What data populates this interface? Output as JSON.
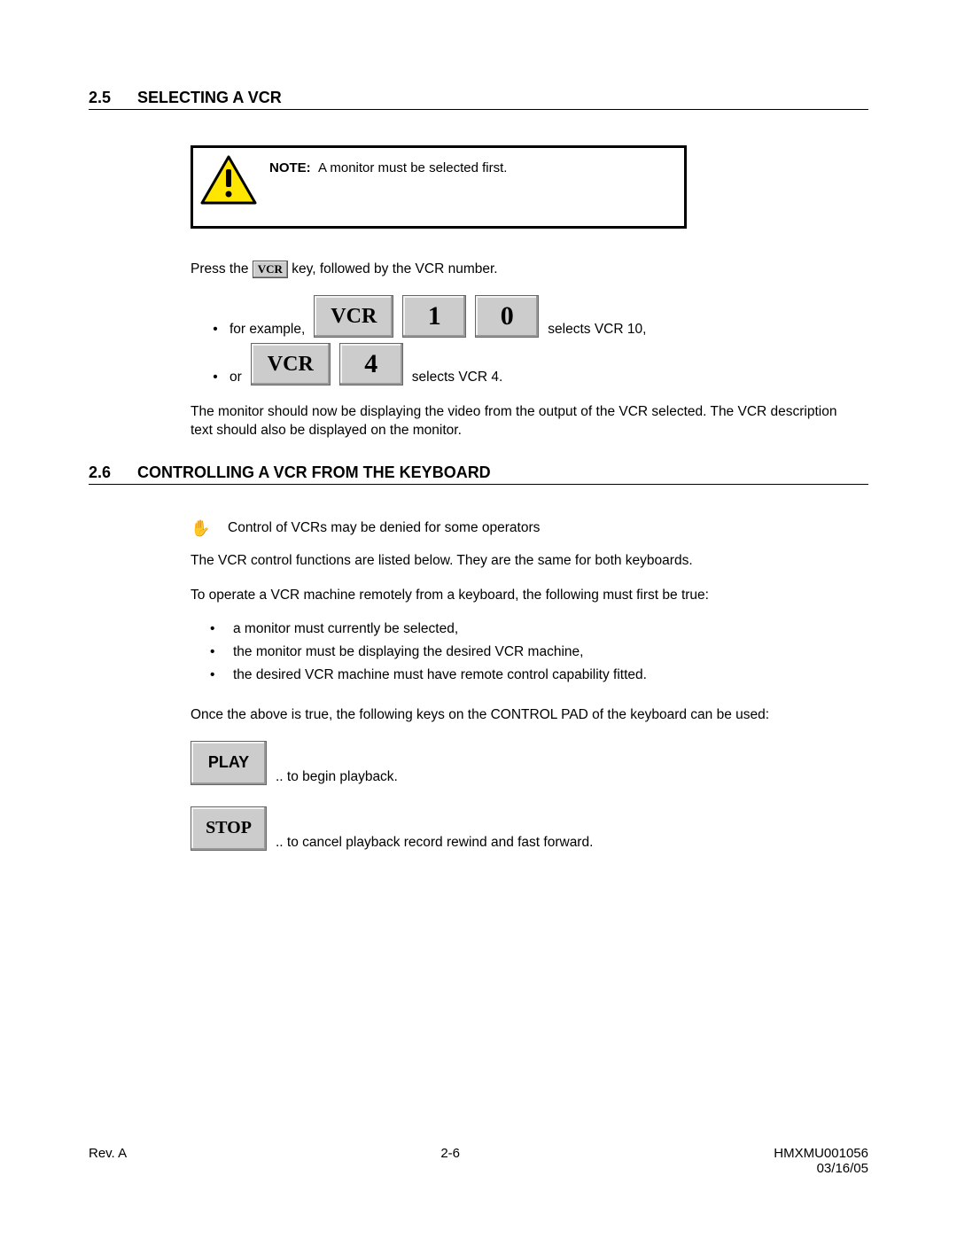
{
  "section25": {
    "num": "2.5",
    "title": "SELECTING A VCR",
    "note_label": "NOTE:",
    "note_text": "A monitor must be selected first.",
    "press_pre": "Press the ",
    "press_key": "VCR",
    "press_post": " key, followed by the VCR number.",
    "ex1_pre": "for example,",
    "ex1_k1": "VCR",
    "ex1_k2": "1",
    "ex1_k3": "0",
    "ex1_post": "selects VCR 10,",
    "ex2_pre": "or",
    "ex2_k1": "VCR",
    "ex2_k2": "4",
    "ex2_post": "selects VCR 4.",
    "after": "The monitor should now be displaying the video from the output of the VCR selected.  The VCR description text should also be displayed on the monitor."
  },
  "section26": {
    "num": "2.6",
    "title": "CONTROLLING A VCR FROM THE KEYBOARD",
    "hand_text": "Control of VCRs may be denied for some operators",
    "p1": "The VCR control functions are listed below.  They are the same for both keyboards.",
    "p2": "To operate a VCR machine remotely from a keyboard, the following must first be true:",
    "bullets": [
      "a monitor must currently be selected,",
      "the monitor must be displaying the desired VCR machine,",
      "the desired VCR machine must have remote control capability fitted."
    ],
    "p3": "Once the above is true, the following keys on the CONTROL PAD of the keyboard can be used:",
    "play_key": "PLAY",
    "play_text": ".. to begin playback.",
    "stop_key": "STOP",
    "stop_text": ".. to cancel playback record rewind and fast forward."
  },
  "footer": {
    "rev": "Rev. A",
    "page": "2-6",
    "doc": "HMXMU001056",
    "date": "03/16/05"
  }
}
